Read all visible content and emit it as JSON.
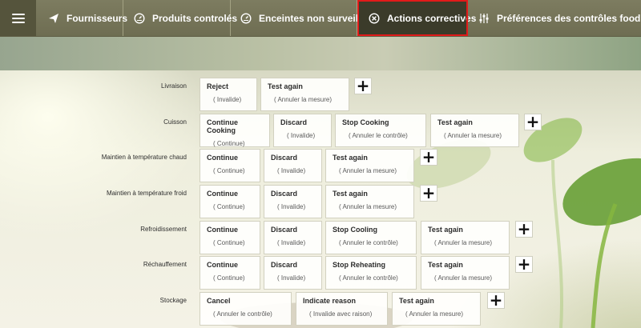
{
  "nav": {
    "tabs": [
      {
        "label": "Fournisseurs",
        "icon": "paper-plane-icon"
      },
      {
        "label": "Produits controlés",
        "icon": "gauge-icon"
      },
      {
        "label": "Enceintes non surveillées",
        "icon": "gauge-icon"
      },
      {
        "label": "Actions correctives",
        "icon": "circle-x-icon",
        "active": true
      },
      {
        "label": "Préférences des contrôles food check",
        "icon": "sliders-icon"
      }
    ]
  },
  "rows": [
    {
      "label": "Livraison",
      "actions": [
        {
          "title": "Reject",
          "sub": "( Invalide)"
        },
        {
          "title": "Test again",
          "sub": "( Annuler la mesure)"
        }
      ]
    },
    {
      "label": "Cuisson",
      "actions": [
        {
          "title": "Continue Cooking",
          "sub": "( Continue)"
        },
        {
          "title": "Discard",
          "sub": "( Invalide)"
        },
        {
          "title": "Stop Cooking",
          "sub": "( Annuler le contrôle)"
        },
        {
          "title": "Test again",
          "sub": "( Annuler la mesure)"
        }
      ]
    },
    {
      "label": "Maintien à température chaud",
      "actions": [
        {
          "title": "Continue",
          "sub": "( Continue)"
        },
        {
          "title": "Discard",
          "sub": "( Invalide)"
        },
        {
          "title": "Test again",
          "sub": "( Annuler la mesure)"
        }
      ]
    },
    {
      "label": "Maintien à température froid",
      "actions": [
        {
          "title": "Continue",
          "sub": "( Continue)"
        },
        {
          "title": "Discard",
          "sub": "( Invalide)"
        },
        {
          "title": "Test again",
          "sub": "( Annuler la mesure)"
        }
      ]
    },
    {
      "label": "Refroidissement",
      "actions": [
        {
          "title": "Continue",
          "sub": "( Continue)"
        },
        {
          "title": "Discard",
          "sub": "( Invalide)"
        },
        {
          "title": "Stop Cooling",
          "sub": "( Annuler le contrôle)"
        },
        {
          "title": "Test again",
          "sub": "( Annuler la mesure)"
        }
      ]
    },
    {
      "label": "Réchauffement",
      "actions": [
        {
          "title": "Continue",
          "sub": "( Continue)"
        },
        {
          "title": "Discard",
          "sub": "( Invalide)"
        },
        {
          "title": "Stop Reheating",
          "sub": "( Annuler le contrôle)"
        },
        {
          "title": "Test again",
          "sub": "( Annuler la mesure)"
        }
      ]
    },
    {
      "label": "Stockage",
      "actions": [
        {
          "title": "Cancel",
          "sub": "( Annuler le contrôle)"
        },
        {
          "title": "Indicate reason",
          "sub": "( Invalide avec raison)"
        },
        {
          "title": "Test again",
          "sub": "( Annuler la mesure)"
        }
      ]
    }
  ],
  "add_symbol": "+",
  "colors": {
    "active_outline": "#e11a1a",
    "nav_bg": "#757458"
  }
}
